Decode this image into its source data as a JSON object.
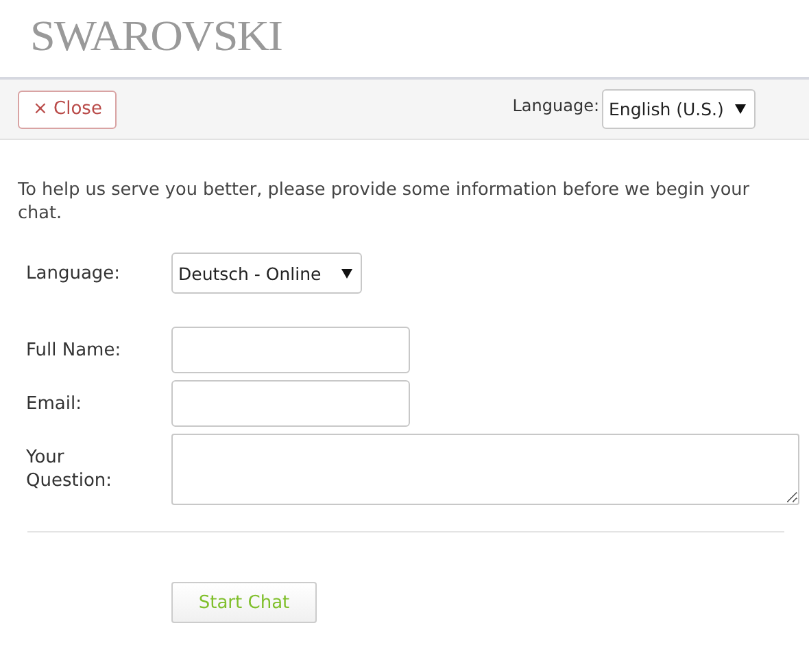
{
  "logo": "SWAROVSKI",
  "toolbar": {
    "close_button": "× Close",
    "language_label": "Language:",
    "language_value": "English (U.S.)"
  },
  "intro": "To help us serve you better, please provide some information before we begin your chat.",
  "fields": [
    {
      "kind": "select",
      "label": "Language:",
      "value": "Deutsch - Online"
    },
    {
      "kind": "input",
      "label": "Full Name:"
    },
    {
      "kind": "input",
      "label": "Email:"
    },
    {
      "kind": "textarea",
      "label": "Your Question:"
    }
  ],
  "submit_button": "Start Chat"
}
